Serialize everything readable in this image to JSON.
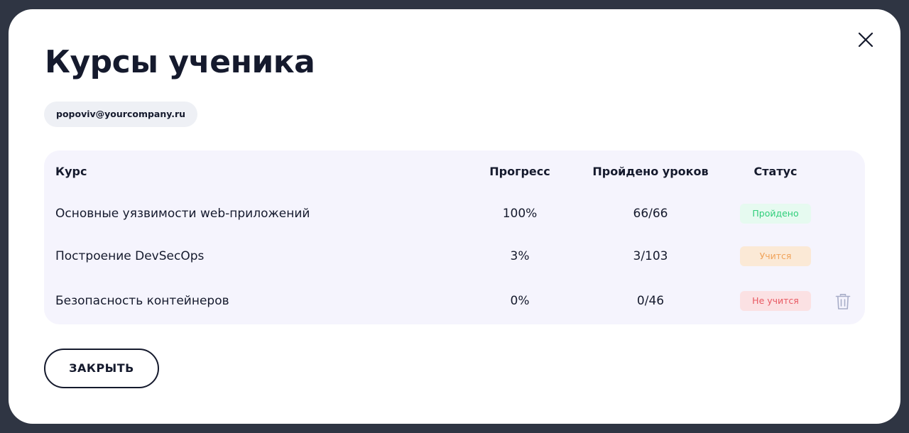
{
  "modal": {
    "title": "Курсы ученика",
    "close_icon": "close-icon"
  },
  "student": {
    "email": "popoviv@yourcompany.ru"
  },
  "table": {
    "headers": {
      "course": "Курс",
      "progress": "Прогресс",
      "lessons": "Пройдено уроков",
      "status": "Статус"
    },
    "rows": [
      {
        "course": "Основные уязвимости web-приложений",
        "progress": "100%",
        "lessons": "66/66",
        "status": "Пройдено",
        "status_kind": "done",
        "status_color": "#2fce7a"
      },
      {
        "course": "Построение DevSecOps",
        "progress": "3%",
        "lessons": "3/103",
        "status": "Учится",
        "status_kind": "learning",
        "status_color": "#f0a35a"
      },
      {
        "course": "Безопасность контейнеров",
        "progress": "0%",
        "lessons": "0/46",
        "status": "Не учится",
        "status_kind": "not",
        "status_color": "#e85962",
        "delete_icon": "trash-icon"
      }
    ]
  },
  "footer": {
    "close_label": "ЗАКРЫТЬ"
  },
  "colors": {
    "backdrop": "#2f3543",
    "text": "#151a2d",
    "table_bg": "#f5f4fd",
    "chip_bg": "#eef0f5"
  }
}
